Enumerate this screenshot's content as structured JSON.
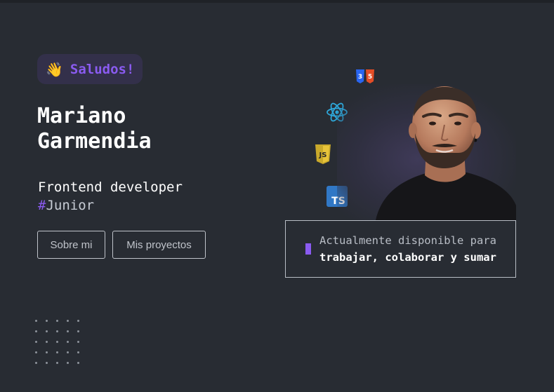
{
  "hero": {
    "greeting": {
      "emoji": "👋",
      "text": "Saludos!"
    },
    "name_first": "Mariano",
    "name_last": "Garmendia",
    "role": "Frontend developer",
    "tag_hash": "#",
    "tag_text": "Junior"
  },
  "buttons": {
    "about": "Sobre mi",
    "projects": "Mis proyectos"
  },
  "tech_icons": {
    "css_label": "3",
    "html_label": "5",
    "js_label": "JS",
    "ts_label": "TS"
  },
  "status": {
    "line1": "Actualmente disponible para",
    "line2": "trabajar, colaborar y sumar"
  },
  "colors": {
    "background": "#282c33",
    "accent": "#8a5bf0",
    "greeting_bg": "#33304a",
    "border": "#c0c4cb"
  }
}
